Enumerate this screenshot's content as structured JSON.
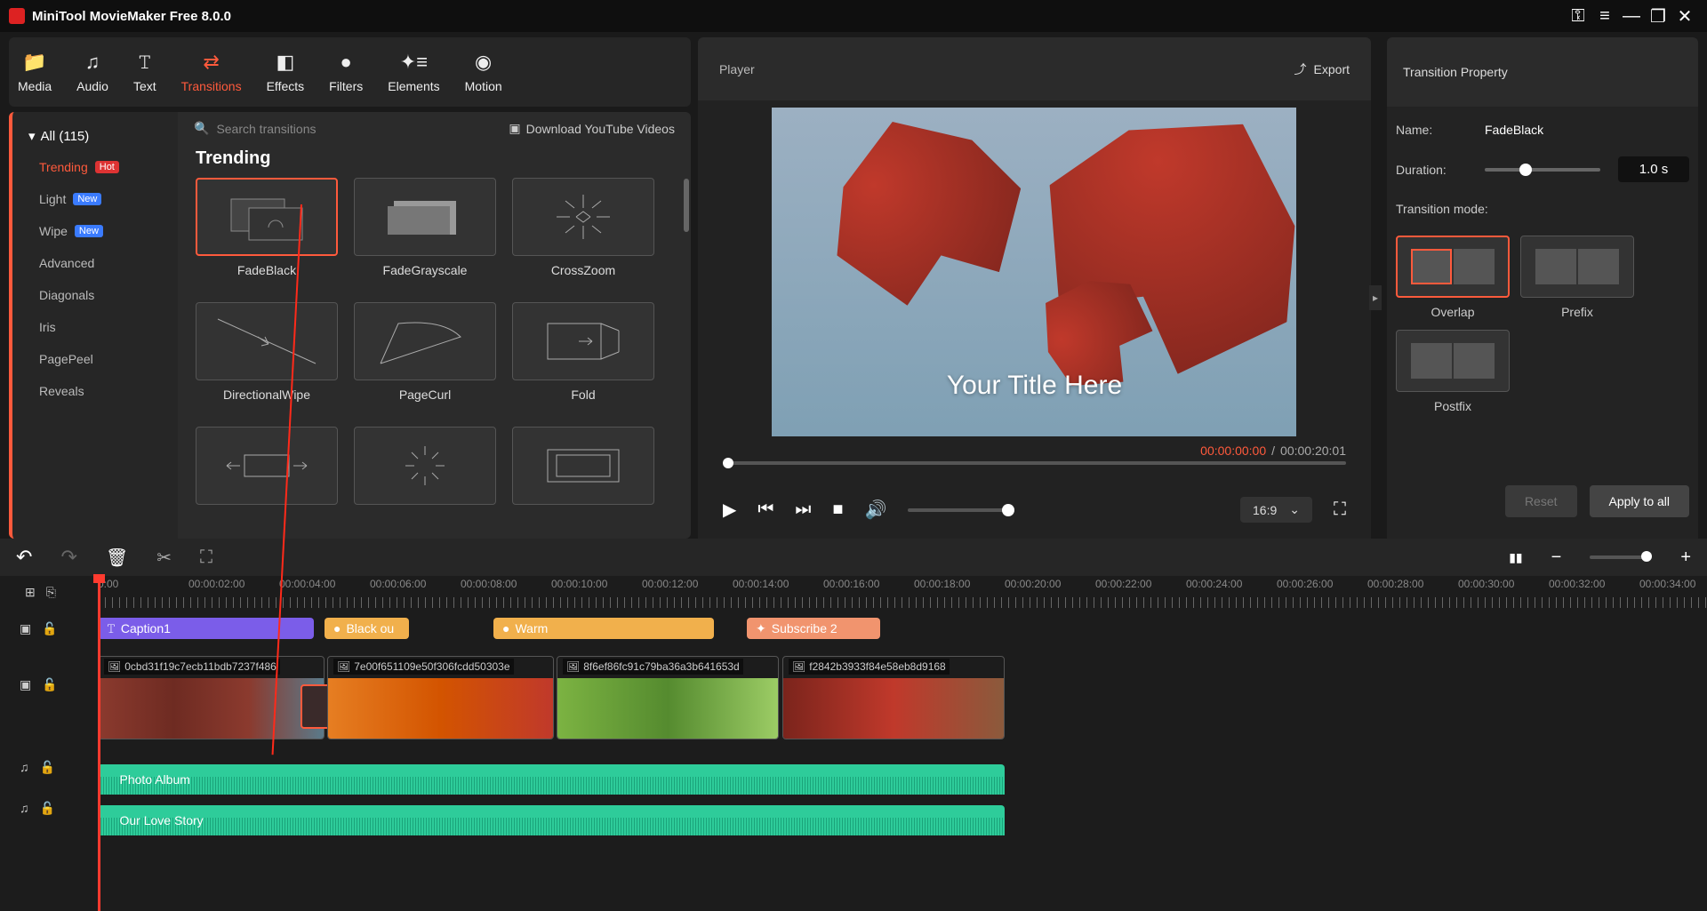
{
  "app_title": "MiniTool MovieMaker Free 8.0.0",
  "tabs": [
    {
      "icon": "📁",
      "label": "Media"
    },
    {
      "icon": "♫",
      "label": "Audio"
    },
    {
      "icon": "𝚃",
      "label": "Text"
    },
    {
      "icon": "⇄",
      "label": "Transitions"
    },
    {
      "icon": "◧",
      "label": "Effects"
    },
    {
      "icon": "●",
      "label": "Filters"
    },
    {
      "icon": "✦≡",
      "label": "Elements"
    },
    {
      "icon": "◉",
      "label": "Motion"
    }
  ],
  "categories": {
    "header": "All (115)",
    "items": [
      {
        "label": "Trending",
        "badge": "Hot",
        "active": true
      },
      {
        "label": "Light",
        "badge": "New"
      },
      {
        "label": "Wipe",
        "badge": "New"
      },
      {
        "label": "Advanced"
      },
      {
        "label": "Diagonals"
      },
      {
        "label": "Iris"
      },
      {
        "label": "PagePeel"
      },
      {
        "label": "Reveals"
      }
    ]
  },
  "search_placeholder": "Search transitions",
  "yt_download": "Download YouTube Videos",
  "section_title": "Trending",
  "transitions": [
    {
      "label": "FadeBlack",
      "selected": true
    },
    {
      "label": "FadeGrayscale"
    },
    {
      "label": "CrossZoom"
    },
    {
      "label": "DirectionalWipe"
    },
    {
      "label": "PageCurl"
    },
    {
      "label": "Fold"
    }
  ],
  "player": {
    "title": "Player",
    "export": "Export",
    "overlay_text": "Your Title Here",
    "time_current": "00:00:00:00",
    "time_total": "00:00:20:01",
    "aspect": "16:9"
  },
  "property": {
    "header": "Transition Property",
    "name_lbl": "Name:",
    "name_val": "FadeBlack",
    "duration_lbl": "Duration:",
    "duration_val": "1.0 s",
    "mode_lbl": "Transition mode:",
    "modes": [
      {
        "label": "Overlap",
        "selected": true
      },
      {
        "label": "Prefix"
      },
      {
        "label": "Postfix"
      }
    ],
    "reset": "Reset",
    "apply": "Apply to all"
  },
  "timeline_ticks": [
    "0:00",
    "00:00:02:00",
    "00:00:04:00",
    "00:00:06:00",
    "00:00:08:00",
    "00:00:10:00",
    "00:00:12:00",
    "00:00:14:00",
    "00:00:16:00",
    "00:00:18:00",
    "00:00:20:00",
    "00:00:22:00",
    "00:00:24:00",
    "00:00:26:00",
    "00:00:28:00",
    "00:00:30:00",
    "00:00:32:00",
    "00:00:34:00"
  ],
  "clips": {
    "caption": "Caption1",
    "black": "Black ou",
    "warm": "Warm",
    "sub": "Subscribe 2"
  },
  "video_clips": [
    {
      "name": "0cbd31f19c7ecb11bdb7237f486"
    },
    {
      "name": "7e00f651109e50f306fcdd50303e"
    },
    {
      "name": "8f6ef86fc91c79ba36a3b641653d"
    },
    {
      "name": "f2842b3933f84e58eb8d9168"
    }
  ],
  "audio_clips": [
    {
      "name": "Photo Album"
    },
    {
      "name": "Our Love Story"
    }
  ]
}
